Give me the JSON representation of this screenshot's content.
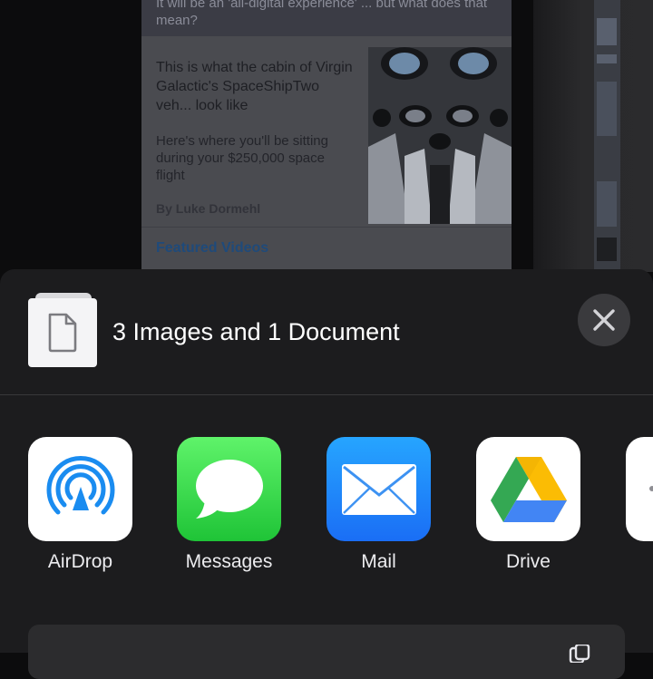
{
  "background_article": {
    "top_text": "It will be an 'all-digital experience' ... but what does that mean?",
    "headline": "This is what the cabin of Virgin Galactic's SpaceShipTwo veh... look like",
    "subhead": "Here's where you'll be sitting during your $250,000 space flight",
    "byline": "By Luke Dormehl",
    "featured": "Featured Videos"
  },
  "share_sheet": {
    "title": "3 Images and 1 Document",
    "close_icon": "xmark-icon",
    "doc_icon": "document-icon",
    "apps": [
      {
        "label": "AirDrop",
        "icon": "airdrop-icon"
      },
      {
        "label": "Messages",
        "icon": "messages-icon"
      },
      {
        "label": "Mail",
        "icon": "mail-icon"
      },
      {
        "label": "Drive",
        "icon": "google-drive-icon"
      }
    ]
  },
  "colors": {
    "sheet_bg": "#1c1c1e",
    "close_bg": "#3a3a3d",
    "airdrop_blue": "#1a8cf0",
    "messages_green": "#2fd448",
    "mail_blue": "#1a7ef5"
  }
}
